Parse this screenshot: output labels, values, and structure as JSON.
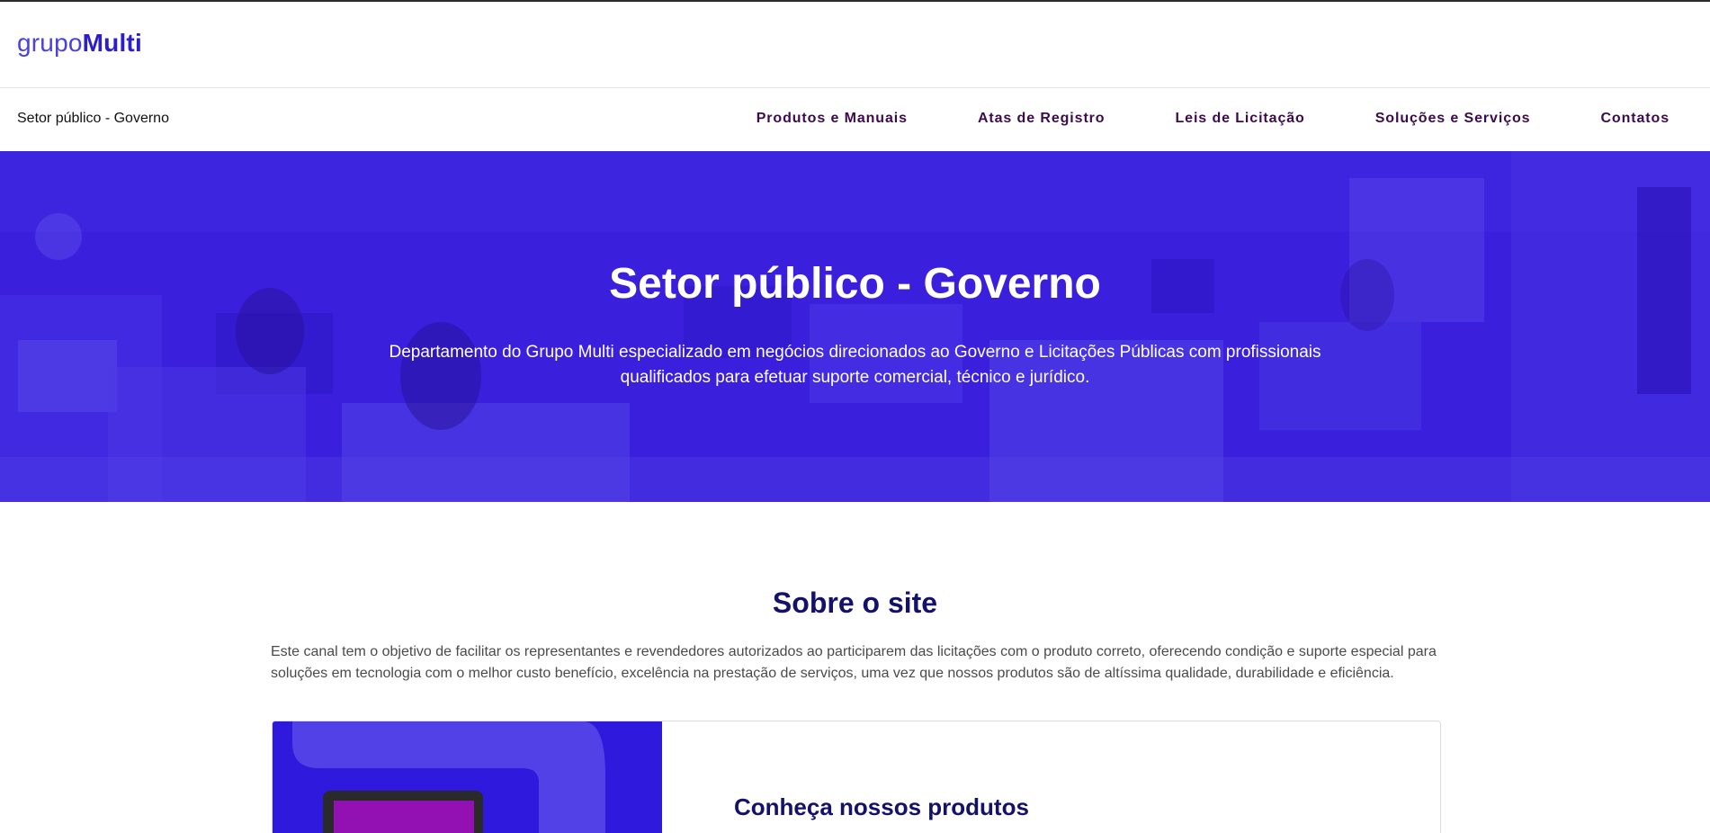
{
  "brand": {
    "logo_light": "grupo",
    "logo_bold": "Multi"
  },
  "nav": {
    "section_label": "Setor público - Governo",
    "links": [
      {
        "label": "Produtos e Manuais"
      },
      {
        "label": "Atas de Registro"
      },
      {
        "label": "Leis de Licitação"
      },
      {
        "label": "Soluções e Serviços"
      },
      {
        "label": "Contatos"
      }
    ]
  },
  "hero": {
    "title": "Setor público - Governo",
    "description": "Departamento do Grupo Multi especializado em negócios direcionados ao Governo e Licitações Públicas com profissionais qualificados para efetuar suporte comercial, técnico e jurídico."
  },
  "about": {
    "title": "Sobre o site",
    "text": "Este canal tem o objetivo de facilitar os representantes e revendedores autorizados ao participarem das licitações com o produto correto, oferecendo condição e suporte especial para soluções em tecnologia com o melhor custo benefício, excelência na prestação de serviços, uma vez que nossos produtos são de altíssima qualidade, durabilidade e eficiência."
  },
  "products_card": {
    "title": "Conheça nossos produtos"
  },
  "colors": {
    "brand_primary": "#2c1fc9",
    "hero_overlay": "#3a1fdc",
    "nav_link": "#3d0b4b",
    "heading": "#14116b",
    "body_text": "#4a4a4a"
  }
}
